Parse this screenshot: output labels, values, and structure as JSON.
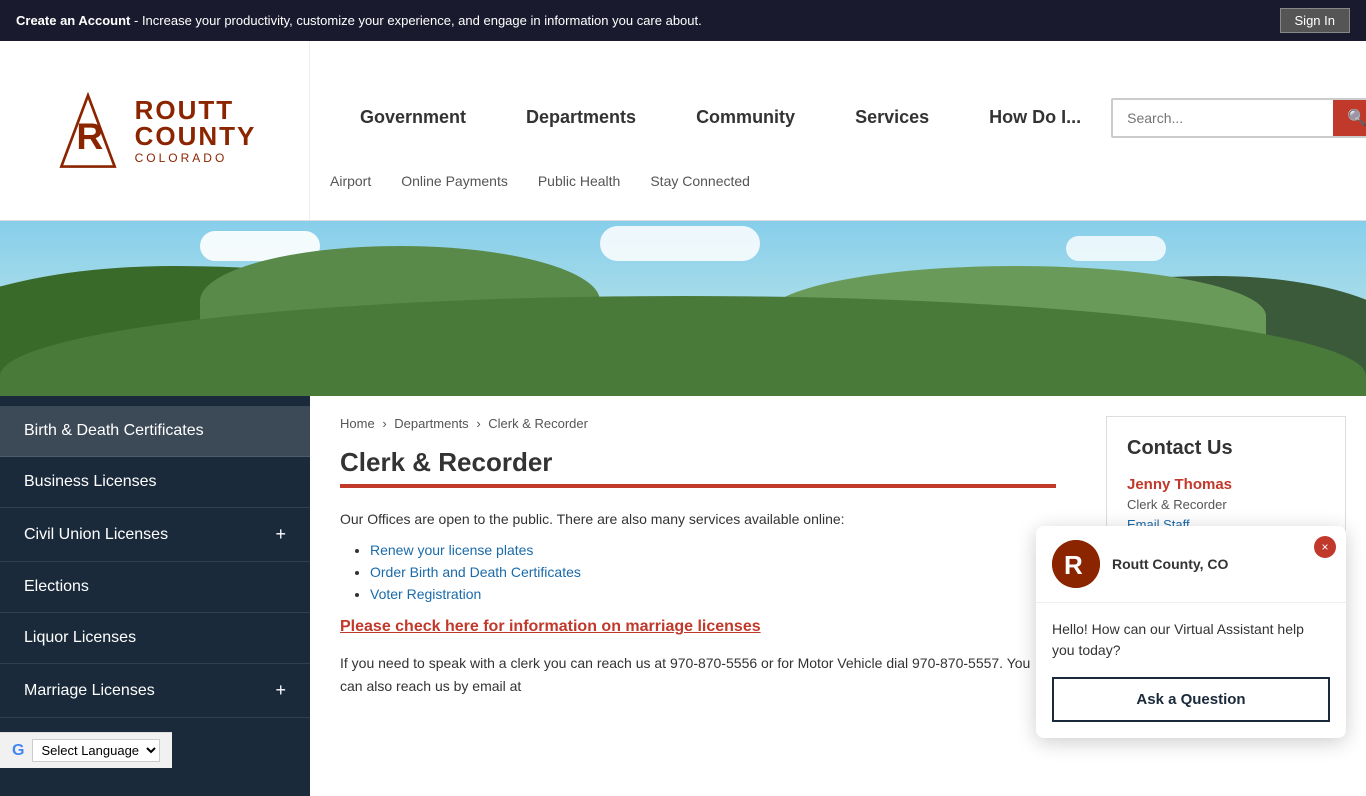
{
  "topBanner": {
    "text1": "Create an Account",
    "text2": " - Increase your productivity, customize your experience, and engage in information you care about.",
    "signInLabel": "Sign In"
  },
  "logo": {
    "r": "R",
    "routt": "ROUTT",
    "county": "COUNTY",
    "colorado": "COLORADO"
  },
  "mainNav": {
    "items": [
      {
        "label": "Government"
      },
      {
        "label": "Departments"
      },
      {
        "label": "Community"
      },
      {
        "label": "Services"
      },
      {
        "label": "How Do I..."
      }
    ]
  },
  "search": {
    "placeholder": "Search..."
  },
  "subNav": {
    "items": [
      {
        "label": "Airport"
      },
      {
        "label": "Online Payments"
      },
      {
        "label": "Public Health"
      },
      {
        "label": "Stay Connected"
      }
    ]
  },
  "sidebar": {
    "items": [
      {
        "label": "Birth & Death Certificates",
        "hasPlus": false,
        "active": true
      },
      {
        "label": "Business Licenses",
        "hasPlus": false
      },
      {
        "label": "Civil Union Licenses",
        "hasPlus": true
      },
      {
        "label": "Elections",
        "hasPlus": false
      },
      {
        "label": "Liquor Licenses",
        "hasPlus": false
      },
      {
        "label": "Marriage Licenses",
        "hasPlus": true
      }
    ]
  },
  "breadcrumb": {
    "home": "Home",
    "departments": "Departments",
    "current": "Clerk & Recorder"
  },
  "page": {
    "title": "Clerk & Recorder",
    "intro": "Our Offices are open to the public. There are also many services available online:",
    "links": [
      {
        "label": "Renew your license plates ",
        "href": "#"
      },
      {
        "label": "Order Birth and Death Certificates",
        "href": "#"
      },
      {
        "label": "Voter Registration",
        "href": "#"
      }
    ],
    "marriageLink": "Please check here for information on marriage licenses",
    "bodyText": "If you need to speak with a clerk you can reach us at 970-870-5556 or for Motor Vehicle dial 970-870-5557. You can also reach us by email at"
  },
  "contact": {
    "title": "Contact Us",
    "name": "Jenny Thomas",
    "role": "Clerk & Recorder",
    "emailLabel": "Email Staff"
  },
  "chatbot": {
    "avatarLabel": "R",
    "countyName": "Routt County, CO",
    "message": "Hello! How can our Virtual Assistant help you today?",
    "askLabel": "Ask a Question",
    "closeLabel": "×"
  },
  "translate": {
    "label": "Select Language",
    "iconLabel": "G"
  }
}
